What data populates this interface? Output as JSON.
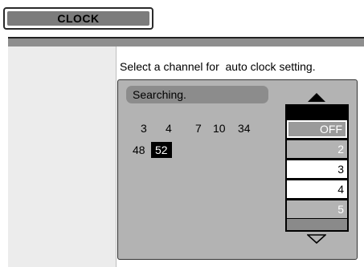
{
  "header": {
    "title": "CLOCK"
  },
  "prompt": {
    "instruction": "Select a channel for  auto clock setting."
  },
  "status": {
    "text": "Searching."
  },
  "channels": [
    "3",
    "4",
    "7",
    "10",
    "34",
    "48",
    "52"
  ],
  "selected_channel": "52",
  "list": {
    "items": [
      "OFF",
      "2",
      "3",
      "4",
      "5"
    ],
    "selected": "OFF"
  },
  "icons": {
    "scroll_up": "triangle-up-icon",
    "scroll_down": "triangle-down-outline-icon"
  }
}
